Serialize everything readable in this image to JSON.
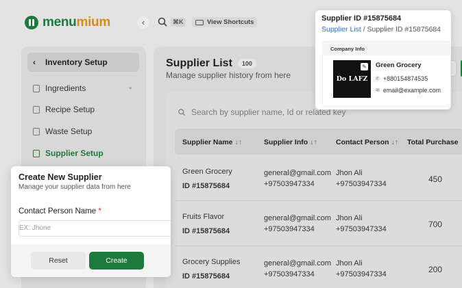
{
  "header": {
    "logo_prefix": "menu",
    "logo_suffix": "mium",
    "search_shortcut": "⌘K",
    "shortcuts_label": "View Shortcuts"
  },
  "sidebar": {
    "section_title": "Inventory Setup",
    "items": [
      {
        "label": "Ingredients",
        "icon": "clipboard-icon"
      },
      {
        "label": "Recipe Setup",
        "icon": "recipe-icon"
      },
      {
        "label": "Waste Setup",
        "icon": "trash-icon"
      },
      {
        "label": "Supplier Setup",
        "icon": "supplier-icon",
        "active": true
      }
    ]
  },
  "main": {
    "title": "Supplier List",
    "count": "100",
    "subtitle": "Manage supplier history from here",
    "search_placeholder": "Search by supplier name, Id or related key",
    "columns": [
      "Supplier Name",
      "Supplier Info",
      "Contact Person",
      "Total Purchase"
    ],
    "rows": [
      {
        "name": "Green Grocery",
        "id": "ID #15875684",
        "email": "general@gmail.com",
        "phone": "+97503947334",
        "contact": "Jhon Ali",
        "contact_phone": "+97503947334",
        "purchase": "450"
      },
      {
        "name": "Fruits Flavor",
        "id": "ID #15875684",
        "email": "general@gmail.com",
        "phone": "+97503947334",
        "contact": "Jhon Ali",
        "contact_phone": "+97503947334",
        "purchase": "700"
      },
      {
        "name": "Grocery Supplies",
        "id": "ID #15875684",
        "email": "general@gmail.com",
        "phone": "+97503947334",
        "contact": "Jhon Ali",
        "contact_phone": "+97503947334",
        "purchase": "200"
      }
    ]
  },
  "supplier_popup": {
    "title": "Supplier ID #15875684",
    "breadcrumb_link": "Supplier List",
    "breadcrumb_sep": " / ",
    "breadcrumb_current": "Supplier ID #15875684",
    "section_label": "Company Info",
    "company_logo_text": "Do LAFZ",
    "company_name": "Green Grocery",
    "phone": "+880154874535",
    "email": "email@example.com"
  },
  "create_modal": {
    "title": "Create New Supplier",
    "subtitle": "Manage your supplier data from here",
    "field_label": "Contact Person Name",
    "required_mark": "*",
    "field_placeholder": "EX: Jhone",
    "reset_label": "Reset",
    "create_label": "Create"
  },
  "colors": {
    "brand": "#1e7a3c",
    "accent": "#d68a1a",
    "link": "#2e6fb8"
  }
}
